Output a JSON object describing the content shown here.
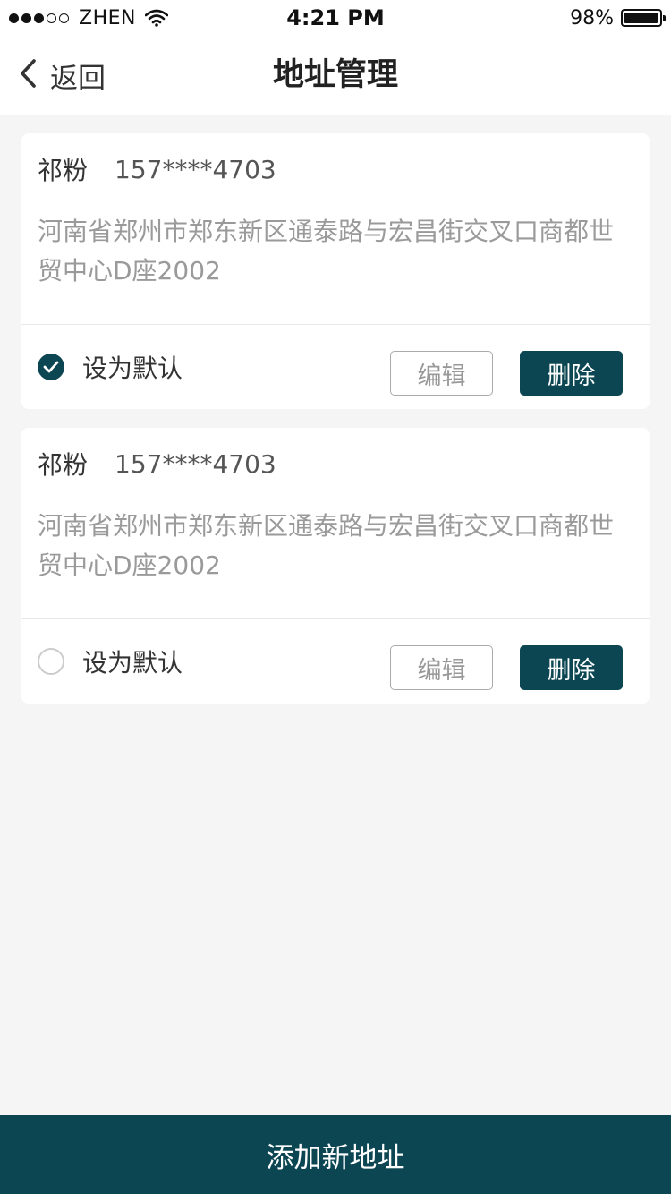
{
  "status_bar": {
    "carrier": "ZHEN",
    "time": "4:21 PM",
    "battery": "98%",
    "battery_level": 0.98,
    "signal_bars_filled": 3,
    "signal_bars_total": 5
  },
  "nav": {
    "back_label": "返回",
    "title": "地址管理"
  },
  "addresses": [
    {
      "name": "祁粉",
      "phone": "157****4703",
      "address": "河南省郑州市郑东新区通泰路与宏昌街交叉口商都世贸中心D座2002",
      "default_label": "设为默认",
      "is_default": true,
      "edit_label": "编辑",
      "delete_label": "删除"
    },
    {
      "name": "祁粉",
      "phone": "157****4703",
      "address": "河南省郑州市郑东新区通泰路与宏昌街交叉口商都世贸中心D座2002",
      "default_label": "设为默认",
      "is_default": false,
      "edit_label": "编辑",
      "delete_label": "删除"
    }
  ],
  "add_button_label": "添加新地址",
  "colors": {
    "primary": "#0b4652",
    "background": "#f5f5f5",
    "address_text": "#9a9a9a"
  },
  "icons": {
    "back": "chevron-left-icon",
    "wifi": "wifi-icon",
    "battery": "battery-icon",
    "check": "check-circle-icon",
    "unchecked": "empty-circle-icon"
  }
}
